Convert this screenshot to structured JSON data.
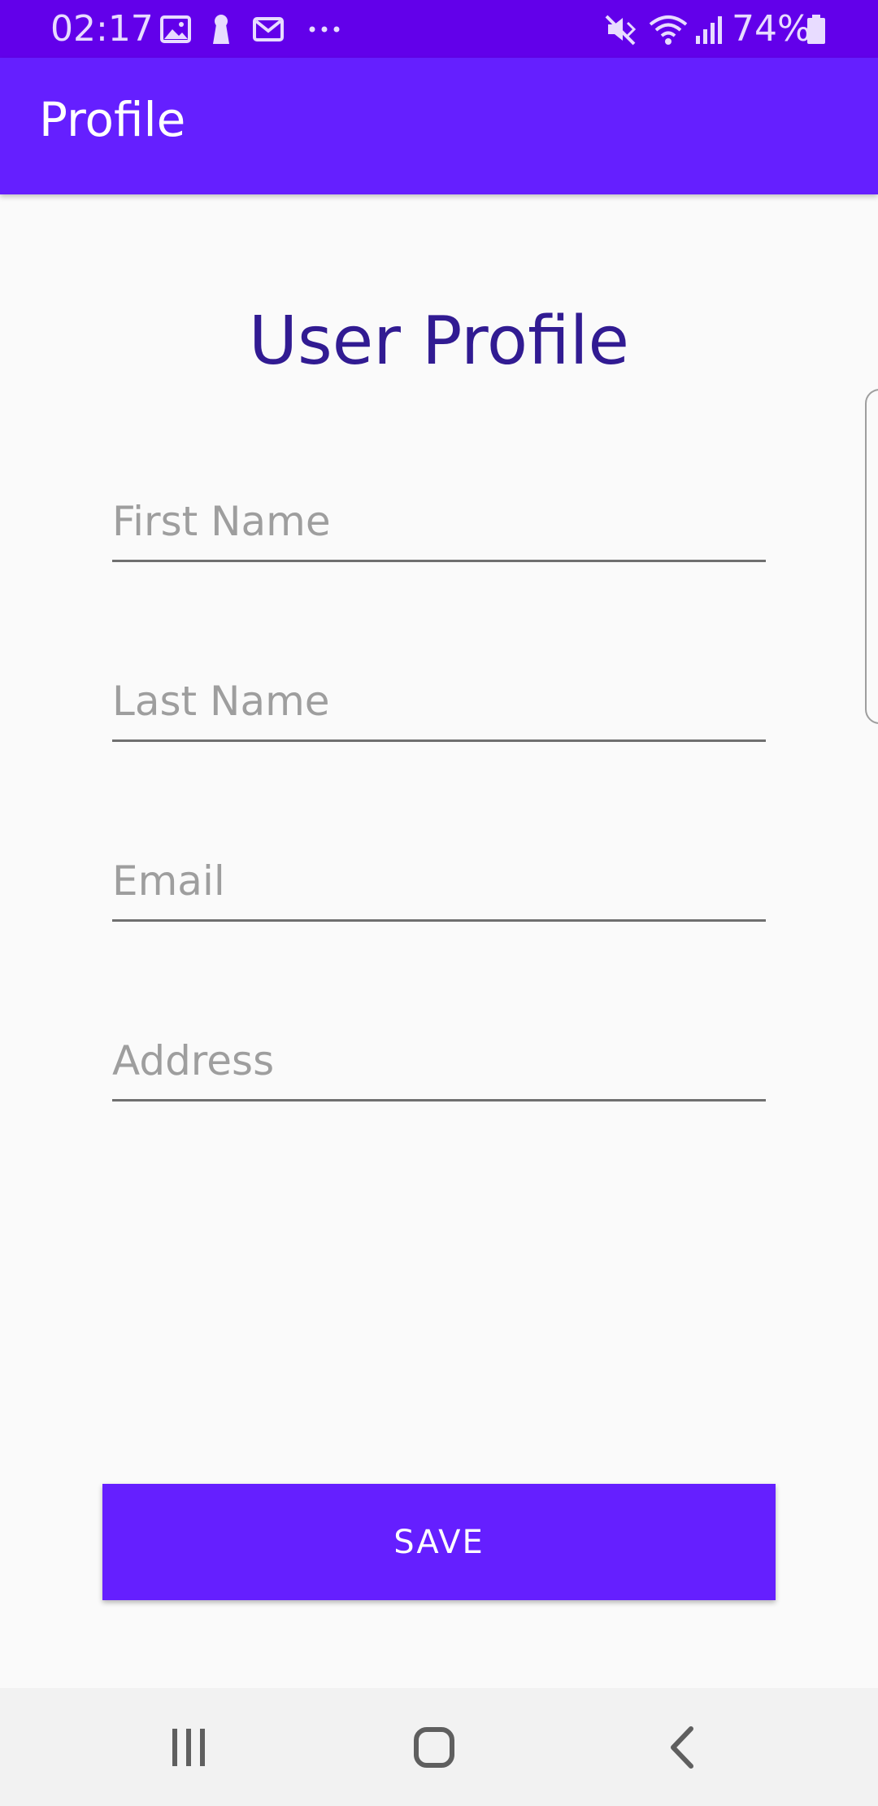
{
  "status_bar": {
    "time": "02:17",
    "battery_percent": "74%",
    "icons": [
      "gallery-icon",
      "keyhole-icon",
      "mail-icon",
      "more-dots-icon",
      "mute-icon",
      "wifi-icon",
      "signal-icon",
      "battery-icon"
    ]
  },
  "app_bar": {
    "title": "Profile"
  },
  "form": {
    "title": "User Profile",
    "first_name_placeholder": "First Name",
    "last_name_placeholder": "Last Name",
    "email_placeholder": "Email",
    "address_placeholder": "Address",
    "save_label": "SAVE"
  },
  "nav_bar": {
    "icons": [
      "recents-icon",
      "home-icon",
      "back-icon"
    ]
  },
  "colors": {
    "status_bar": "#6200ea",
    "app_bar": "#651fff",
    "title_text": "#311b92",
    "background": "#fafafa"
  }
}
